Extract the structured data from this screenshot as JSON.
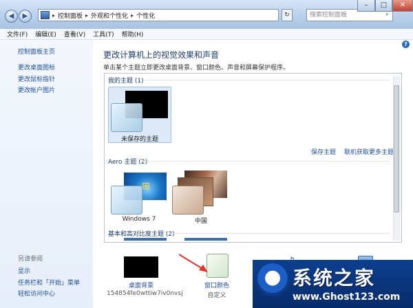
{
  "addressbar": {
    "crumbs": [
      "控制面板",
      "外观和个性化",
      "个性化"
    ],
    "search_placeholder": "搜索控制面板"
  },
  "menubar": {
    "items": [
      "文件(F)",
      "编辑(E)",
      "查看(V)",
      "工具(T)",
      "帮助(H)"
    ]
  },
  "leftpane": {
    "links": [
      "控制面板主页",
      "更改桌面图标",
      "更改鼠标指针",
      "更改帐户图片"
    ],
    "see_also_title": "另请参阅",
    "see_also": [
      "显示",
      "任务栏和「开始」菜单",
      "轻松访问中心"
    ]
  },
  "main": {
    "heading": "更改计算机上的视觉效果和声音",
    "subtitle": "单击某个主题立即更改桌面背景、窗口颜色、声音和屏幕保护程序。",
    "my_themes": {
      "title": "我的主题 (1)",
      "item": "未保存的主题",
      "save": "保存主题",
      "online": "联机获取更多主题"
    },
    "aero": {
      "title": "Aero 主题 (2)",
      "items": [
        "Windows 7",
        "中国"
      ]
    },
    "basic": {
      "title": "基本和高对比度主题 (2)"
    },
    "bottom": [
      {
        "label": "桌面背景",
        "sub": "154854fe0wttiw7iv0nvsj"
      },
      {
        "label": "窗口颜色",
        "sub": "自定义"
      }
    ]
  },
  "watermark": {
    "brand": "系统之家",
    "url": "www.Ghost123.com"
  },
  "colors": {
    "link": "#1e4fa0",
    "heading": "#1a3c72",
    "selection": "#dbe9f9"
  }
}
